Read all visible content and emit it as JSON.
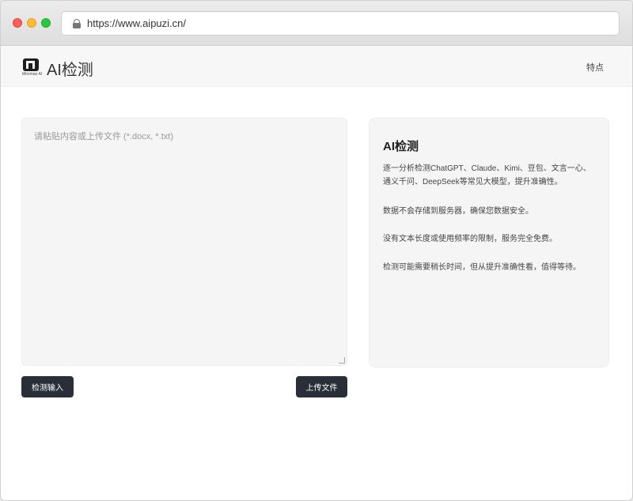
{
  "browser": {
    "url": "https://www.aipuzi.cn/"
  },
  "header": {
    "logo_text": "Minimax AI",
    "title": "AI检测",
    "nav_features": "特点"
  },
  "input": {
    "placeholder": "请粘贴内容或上传文件 (*.docx, *.txt)",
    "value": ""
  },
  "buttons": {
    "detect": "检测输入",
    "upload": "上传文件"
  },
  "info": {
    "title": "AI检测",
    "paragraphs": [
      "逐一分析检测ChatGPT、Claude、Kimi、豆包、文言一心、通义千问、DeepSeek等常见大模型，提升准确性。",
      "数据不会存储到服务器，确保您数据安全。",
      "没有文本长度或使用频率的限制，服务完全免费。",
      "检测可能需要稍长时间，但从提升准确性看，值得等待。"
    ]
  }
}
